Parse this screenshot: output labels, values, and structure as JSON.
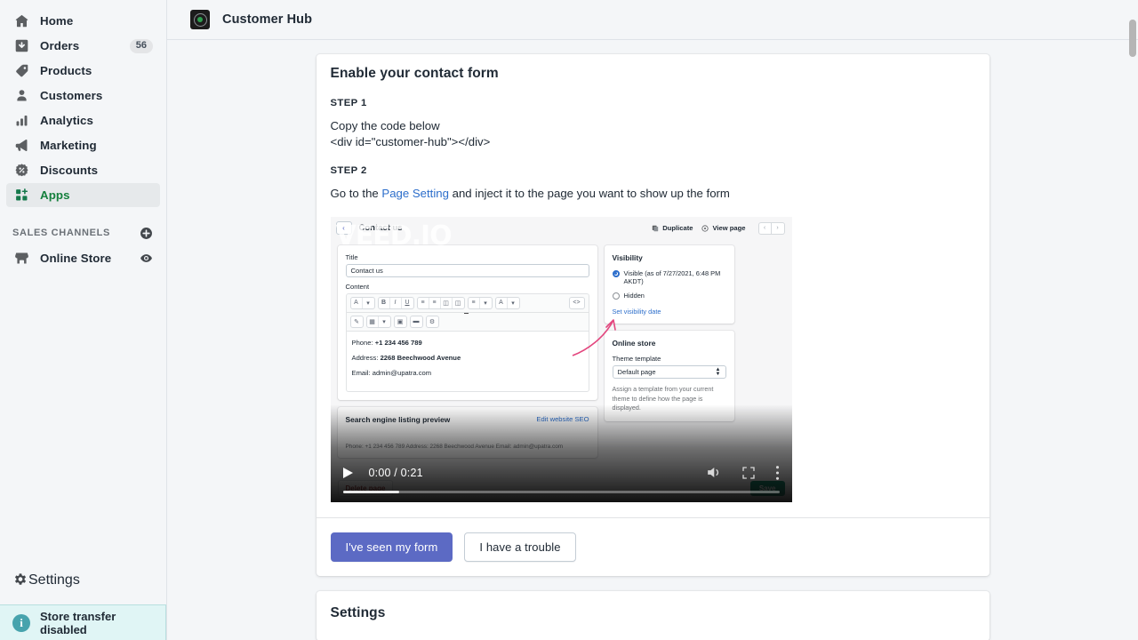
{
  "sidebar": {
    "items": [
      {
        "label": "Home",
        "icon": "home-icon",
        "badge": null,
        "active": false
      },
      {
        "label": "Orders",
        "icon": "orders-icon",
        "badge": "56",
        "active": false
      },
      {
        "label": "Products",
        "icon": "products-tag-icon",
        "badge": null,
        "active": false
      },
      {
        "label": "Customers",
        "icon": "customers-person-icon",
        "badge": null,
        "active": false
      },
      {
        "label": "Analytics",
        "icon": "analytics-bars-icon",
        "badge": null,
        "active": false
      },
      {
        "label": "Marketing",
        "icon": "marketing-megaphone-icon",
        "badge": null,
        "active": false
      },
      {
        "label": "Discounts",
        "icon": "discounts-percent-icon",
        "badge": null,
        "active": false
      },
      {
        "label": "Apps",
        "icon": "apps-grid-icon",
        "badge": null,
        "active": true
      }
    ],
    "sales_channels_header": "SALES CHANNELS",
    "sales_channels": [
      {
        "label": "Online Store",
        "icon": "store-icon",
        "trailing_icon": "eye-icon"
      }
    ],
    "settings_label": "Settings",
    "store_banner": "Store transfer disabled",
    "banner_color": "#e0f5f5"
  },
  "topbar": {
    "app_title": "Customer Hub",
    "app_icon": "customer-hub-logo-icon"
  },
  "main": {
    "card": {
      "title": "Enable your contact form",
      "step1_label": "STEP 1",
      "step1_text": "Copy the code below",
      "step1_code": "<div id=\"customer-hub\"></div>",
      "step2_label": "STEP 2",
      "step2_prefix": "Go to the ",
      "step2_link": "Page Setting",
      "step2_suffix": " and inject it to the page you want to show up the form"
    },
    "actions": {
      "primary_label": "I've seen my form",
      "secondary_label": "I have a trouble",
      "primary_color": "#5c6ac4"
    },
    "settings_card": {
      "title": "Settings"
    }
  },
  "video": {
    "watermark": "VEED.IO",
    "current_time": "0:00",
    "duration": "0:21",
    "time_display": "0:00 / 0:21",
    "progress_percent": 13,
    "controls": {
      "play": "play-icon",
      "mute": "volume-icon",
      "fullscreen": "fullscreen-icon",
      "more": "more-options-icon"
    },
    "frame": {
      "page_title": "Contact us",
      "duplicate_label": "Duplicate",
      "view_page_label": "View page",
      "prev_label": "‹",
      "next_label": "›",
      "title_field_label": "Title",
      "title_field_value": "Contact us",
      "content_field_label": "Content",
      "toolbar_row1": [
        "A",
        "▾",
        "B",
        "I",
        "U",
        "≡",
        "≡",
        "⌸",
        "⌸",
        "≣",
        "▾",
        "A",
        "▾"
      ],
      "toolbar_code_icon": "<>",
      "toolbar_row2": [
        "✐",
        "▦",
        "▾",
        "❑",
        "▬",
        "⚙"
      ],
      "content_lines": [
        {
          "label": "Phone: ",
          "value": "+1 234 456 789"
        },
        {
          "label": "Address: ",
          "value": "2268 Beechwood Avenue"
        },
        {
          "label": "Email: ",
          "value": "admin@upatra.com"
        }
      ],
      "seo_title": "Search engine listing preview",
      "seo_link": "Edit website SEO",
      "seo_meta": "Phone: +1 234 456 789 Address: 2268 Beechwood Avenue Email: admin@upatra.com",
      "visibility_title": "Visibility",
      "visibility_option_visible": "Visible (as of 7/27/2021, 6:48 PM AKDT)",
      "visibility_option_hidden": "Hidden",
      "visibility_link": "Set visibility date",
      "online_store_title": "Online store",
      "theme_template_label": "Theme template",
      "theme_template_value": "Default page",
      "theme_help": "Assign a template from your current theme to define how the page is displayed.",
      "delete_label": "Delete page",
      "save_label": "Save"
    }
  }
}
